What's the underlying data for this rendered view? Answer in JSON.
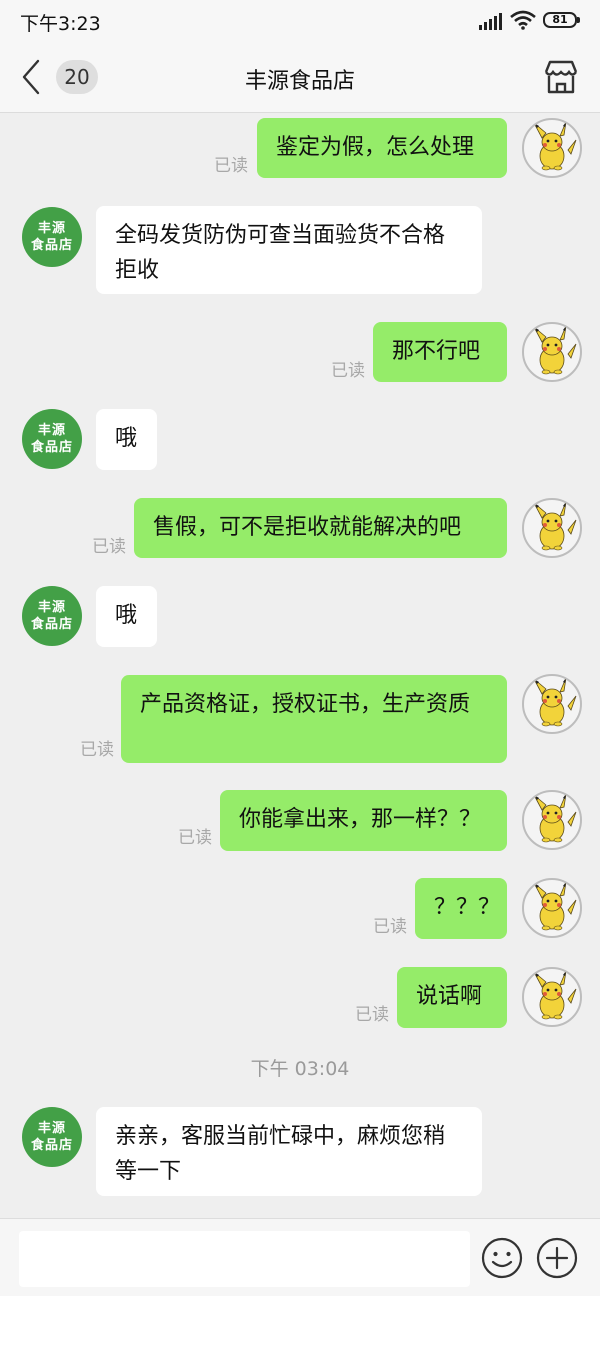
{
  "status_bar": {
    "time": "下午3:23",
    "battery": "81",
    "icons": [
      "signal-icon",
      "wifi-icon",
      "battery-icon"
    ]
  },
  "header": {
    "back_icon": "chevron-left-icon",
    "unread_count": "20",
    "title": "丰源食品店",
    "store_icon": "storefront-icon"
  },
  "shop": {
    "avatar_line1": "丰源",
    "avatar_line2": "食品店",
    "avatar_color": "#43a047"
  },
  "me": {
    "avatar": "pikachu-avatar"
  },
  "colors": {
    "my_bubble": "#95ec69",
    "their_bubble": "#ffffff",
    "background": "#efefef"
  },
  "messages": [
    {
      "from": "me",
      "text": "鉴定为假，怎么处理",
      "read": "已读"
    },
    {
      "from": "shop",
      "text": "全码发货防伪可查当面验货不合格拒收"
    },
    {
      "from": "me",
      "text": "那不行吧",
      "read": "已读"
    },
    {
      "from": "shop",
      "text": "哦"
    },
    {
      "from": "me",
      "text": "售假，可不是拒收就能解决的吧",
      "read": "已读"
    },
    {
      "from": "shop",
      "text": "哦"
    },
    {
      "from": "me",
      "text": "产品资格证，授权证书，生产资质",
      "read": "已读"
    },
    {
      "from": "me",
      "text": "你能拿出来，那一样？？",
      "read": "已读"
    },
    {
      "from": "me",
      "text": "？？？",
      "read": "已读"
    },
    {
      "from": "me",
      "text": "说话啊",
      "read": "已读"
    },
    {
      "from": "shop",
      "text": "亲亲，客服当前忙碌中，麻烦您稍等一下"
    }
  ],
  "timestamp": "下午 03:04",
  "input": {
    "value": "",
    "emoji_icon": "emoji-icon",
    "add_icon": "plus-circle-icon"
  }
}
